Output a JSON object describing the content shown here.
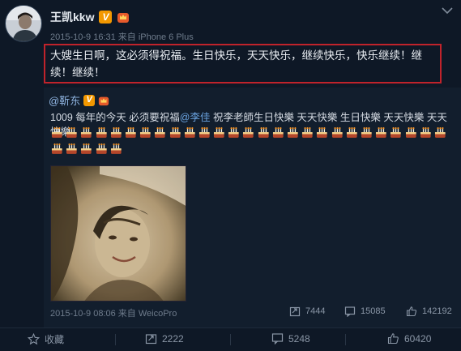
{
  "post": {
    "author": "王凯kkw",
    "timestamp": "2015-10-9 16:31",
    "source_prefix": "来自",
    "source": "iPhone 6 Plus",
    "text": "大嫂生日啊，这必须得祝福。生日快乐，天天快乐，继续快乐，快乐继续！继续！继续！"
  },
  "repost": {
    "author": "@靳东",
    "text_before": "1009  每年的今天 必须要祝福",
    "mention": "@李佳",
    "text_after": " 祝李老師生日快樂 天天快樂 生日快樂 天天快樂 天天快樂",
    "timestamp": "2015-10-9 08:06",
    "source_prefix": "来自",
    "source": "WeicoPro",
    "stats": {
      "reposts": "7444",
      "comments": "15085",
      "likes": "142192"
    }
  },
  "actions": {
    "favorite": "收藏",
    "repost": "2222",
    "comment": "5248",
    "like": "60420"
  },
  "colors": {
    "highlight": "#c0232b",
    "verified": "#f39800",
    "mention": "#6aa3e0"
  },
  "icons": {
    "verified": "verified-v-icon",
    "crown": "crown-icon",
    "menu": "chevron-down-icon",
    "cake": "birthday-cake-icon",
    "repost": "repost-icon",
    "comment": "comment-icon",
    "like": "thumbs-up-icon",
    "favorite": "star-icon"
  }
}
